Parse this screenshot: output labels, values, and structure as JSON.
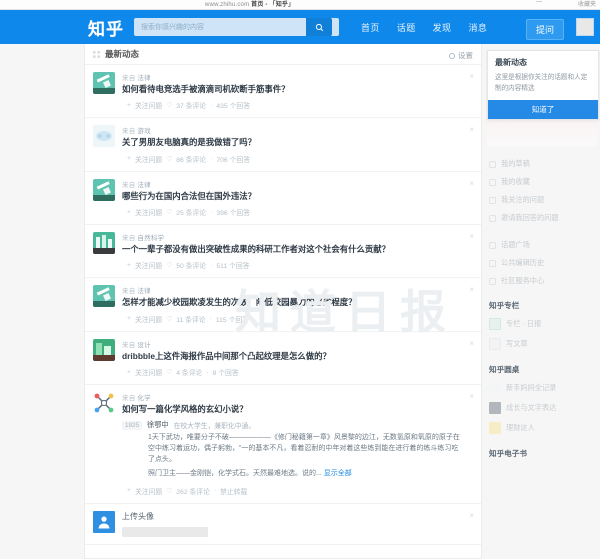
{
  "browser": {
    "url_prefix": "www.zhihu.com",
    "url_bold": "首页 - 「知乎」",
    "minimize": "—",
    "right_label": "收藏夹"
  },
  "topbar": {
    "logo": "知乎",
    "search_placeholder": "搜索你感兴趣的内容",
    "search_value": "",
    "search_icon": "search-icon",
    "nav": [
      {
        "label": "首页"
      },
      {
        "label": "话题"
      },
      {
        "label": "发现"
      },
      {
        "label": "消息"
      }
    ],
    "ask_label": "提问"
  },
  "feed": {
    "title": "最新动态",
    "settings_label": "设置",
    "watermark": "知道日报",
    "items": [
      {
        "source_prefix": "来自",
        "source": "法律",
        "title": "如何看待电竞选手被滴滴司机砍断手筋事件？",
        "follow": "关注问题",
        "comments": "37 条评论",
        "answers": "435 个回答",
        "thumb": "gavel-icon",
        "thumb_color": "#5ec3b0"
      },
      {
        "source_prefix": "来自",
        "source": "游戏",
        "title": "关了男朋友电脑真的是我做错了吗？",
        "follow": "关注问题",
        "comments": "86 条评论",
        "answers": "706 个回答",
        "thumb": "game-icon",
        "thumb_color": "#eef6fa"
      },
      {
        "source_prefix": "来自",
        "source": "法律",
        "title": "哪些行为在国内合法但在国外违法？",
        "follow": "关注问题",
        "comments": "25 条评论",
        "answers": "396 个回答",
        "thumb": "gavel-icon",
        "thumb_color": "#5ec3b0"
      },
      {
        "source_prefix": "来自",
        "source": "自然科学",
        "title": "一个一辈子都没有做出突破性成果的科研工作者对这个社会有什么贡献？",
        "follow": "关注问题",
        "comments": "50 条评论",
        "answers": "511 个回答",
        "thumb": "beaker-icon",
        "thumb_color": "#49b79a"
      },
      {
        "source_prefix": "来自",
        "source": "法律",
        "title": "怎样才能减少校园欺凌发生的次数，降低校园暴力的恶劣程度？",
        "follow": "关注问题",
        "comments": "11 条评论",
        "answers": "115 个回答",
        "thumb": "gavel-icon",
        "thumb_color": "#5ec3b0"
      },
      {
        "source_prefix": "来自",
        "source": "设计",
        "title": "dribbble上这件海报作品中间那个凸起纹理是怎么做的？",
        "follow": "关注问题",
        "comments": "4 条评论",
        "answers": "8 个回答",
        "thumb": "poster-icon",
        "thumb_color": "#3fae7c"
      }
    ],
    "answer_item": {
      "source_prefix": "来自",
      "source": "化学",
      "title": "如何写一篇化学风格的玄幻小说？",
      "badge": "1925",
      "author": "徐鄂中",
      "author_desc": "在校大学生，兼职化中通。",
      "text": "1天下武功，唯要分子不破——————《修门秘籍第一章》风景黎的边江，无数氢原和氧原的原子在空中练习着运功，偶子躬勃，“一的基本不凡，看着忍耐的中年对着这些练到能在进行着的练斗练习吃了点头。",
      "text2": "照门卫主——金刚铠，化学式石。天然最难地选。说的...",
      "more": "显示全部",
      "follow": "关注问题",
      "comments": "262 条评论",
      "reprint": "禁止转载"
    },
    "upload_item": {
      "title": "上传头像",
      "thumb": "user-avatar-icon"
    }
  },
  "sidebar": {
    "popover": {
      "title": "最新动态",
      "body": "这里是根据你关注的话题和人定制的内容精选",
      "ok_label": "知道了"
    },
    "links": [
      {
        "label": "我的草稿",
        "icon": "draft-icon"
      },
      {
        "label": "我的收藏",
        "icon": "bookmark-icon"
      },
      {
        "label": "我关注的问题",
        "icon": "question-icon"
      },
      {
        "label": "邀请我回答的问题",
        "icon": "invite-icon"
      }
    ],
    "links2": [
      {
        "label": "话题广场",
        "icon": "grid-icon"
      },
      {
        "label": "公共编辑历史",
        "icon": "history-icon"
      },
      {
        "label": "社区服务中心",
        "icon": "service-icon"
      }
    ],
    "column": {
      "heading": "知乎专栏",
      "items": [
        {
          "label": "专栏 · 日报",
          "color": "#d9f0e8"
        },
        {
          "label": "写文章",
          "color": "#f0f2f4"
        }
      ]
    },
    "roundtable": {
      "heading": "知乎圆桌",
      "items": [
        {
          "label": "新手妈妈全记录",
          "color": "#f4f5f6"
        },
        {
          "label": "成长与文字表达",
          "color": "#6e7a86"
        },
        {
          "label": "理财这人",
          "color": "#f6e69a"
        }
      ]
    },
    "ebook": {
      "heading": "知乎电子书"
    }
  }
}
